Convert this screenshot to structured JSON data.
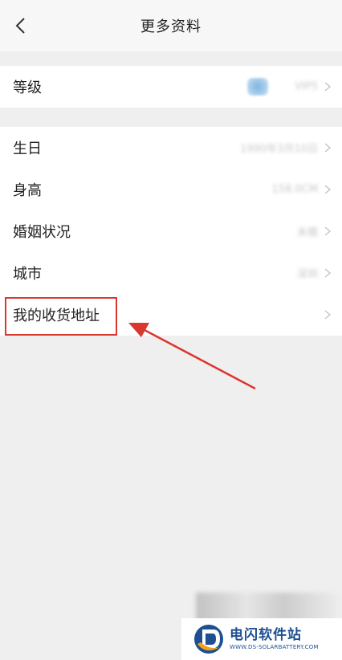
{
  "header": {
    "title": "更多资料",
    "back_icon": "chevron-left-icon"
  },
  "groups": [
    {
      "rows": [
        {
          "label": "等级",
          "value": "VIP5",
          "has_badge": true
        }
      ]
    },
    {
      "rows": [
        {
          "label": "生日",
          "value": "1990年3月10日"
        },
        {
          "label": "身高",
          "value": "158.0CM"
        },
        {
          "label": "婚姻状况",
          "value": "未婚"
        },
        {
          "label": "城市",
          "value": "深圳"
        },
        {
          "label": "我的收货地址",
          "value": ""
        }
      ]
    }
  ],
  "annotation": {
    "highlight_color": "#d9382f",
    "highlighted_item": "我的收货地址"
  },
  "watermark": {
    "name": "电闪软件站",
    "url": "WWW.DS-SOLARBATTERY.COM",
    "brand_color": "#1d4f91",
    "accent_color": "#f2a11f"
  }
}
